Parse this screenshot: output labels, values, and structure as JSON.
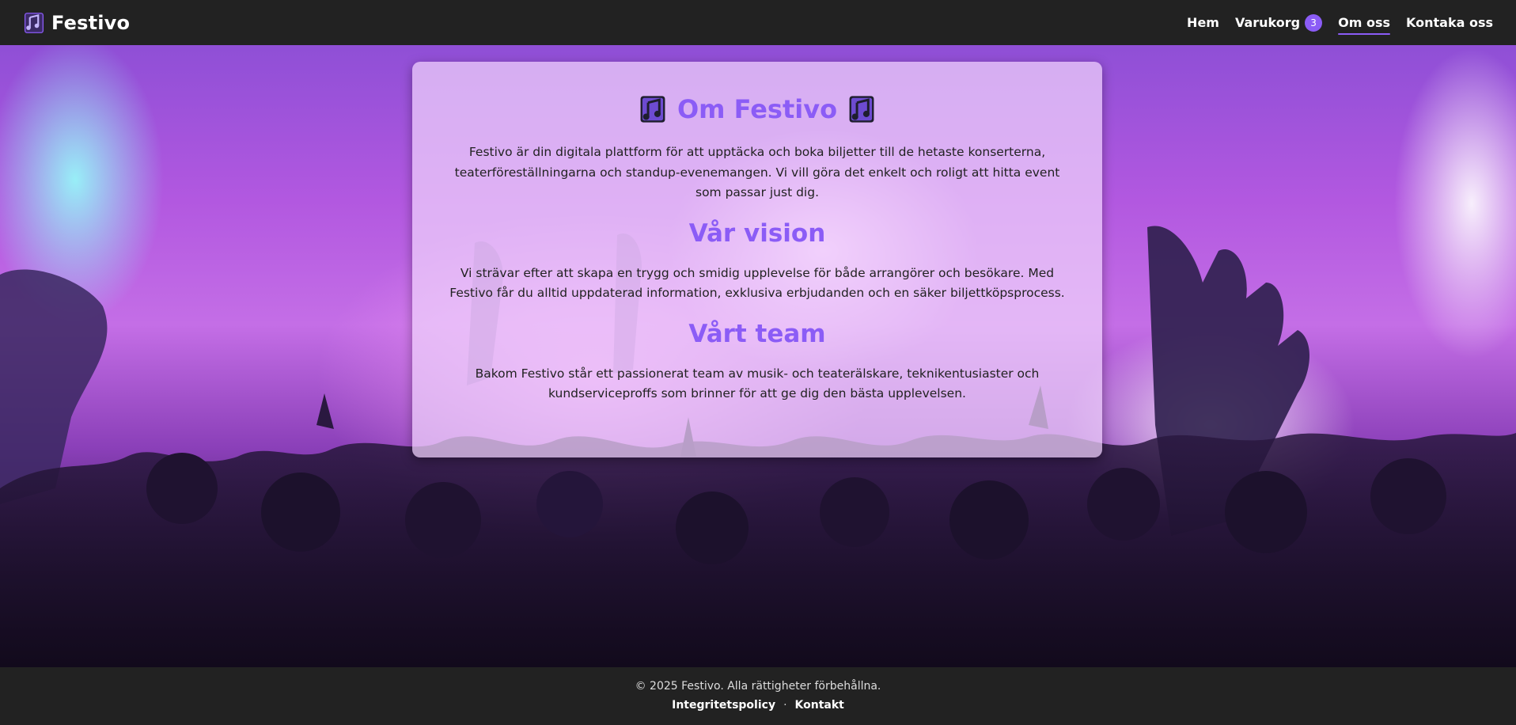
{
  "header": {
    "brand": "Festivo",
    "brand_icon": "music-notes-icon",
    "nav": [
      {
        "label": "Hem"
      },
      {
        "label": "Varukorg",
        "badge": "3"
      },
      {
        "label": "Om oss",
        "active": true
      },
      {
        "label": "Kontaka oss"
      }
    ]
  },
  "main": {
    "title": "Om Festivo",
    "title_icon": "music-notes-icon",
    "intro": "Festivo är din digitala plattform för att upptäcka och boka biljetter till de hetaste konserterna, teaterföreställningarna och standup-evenemangen. Vi vill göra det enkelt och roligt att hitta event som passar just dig.",
    "vision_heading": "Vår vision",
    "vision_text": "Vi strävar efter att skapa en trygg och smidig upplevelse för både arrangörer och besökare. Med Festivo får du alltid uppdaterad information, exklusiva erbjudanden och en säker biljettköpsprocess.",
    "team_heading": "Vårt team",
    "team_text": "Bakom Festivo står ett passionerat team av musik- och teaterälskare, teknikentusiaster och kundserviceproffs som brinner för att ge dig den bästa upplevelsen."
  },
  "footer": {
    "copyright": "© 2025 Festivo. Alla rättigheter förbehållna.",
    "links": [
      "Integritetspolicy",
      "Kontakt"
    ],
    "separator": "·"
  },
  "colors": {
    "accent": "#8b5cf6",
    "header_bg": "#222222",
    "footer_bg": "#222222",
    "card_bg": "#f0d2fc"
  }
}
